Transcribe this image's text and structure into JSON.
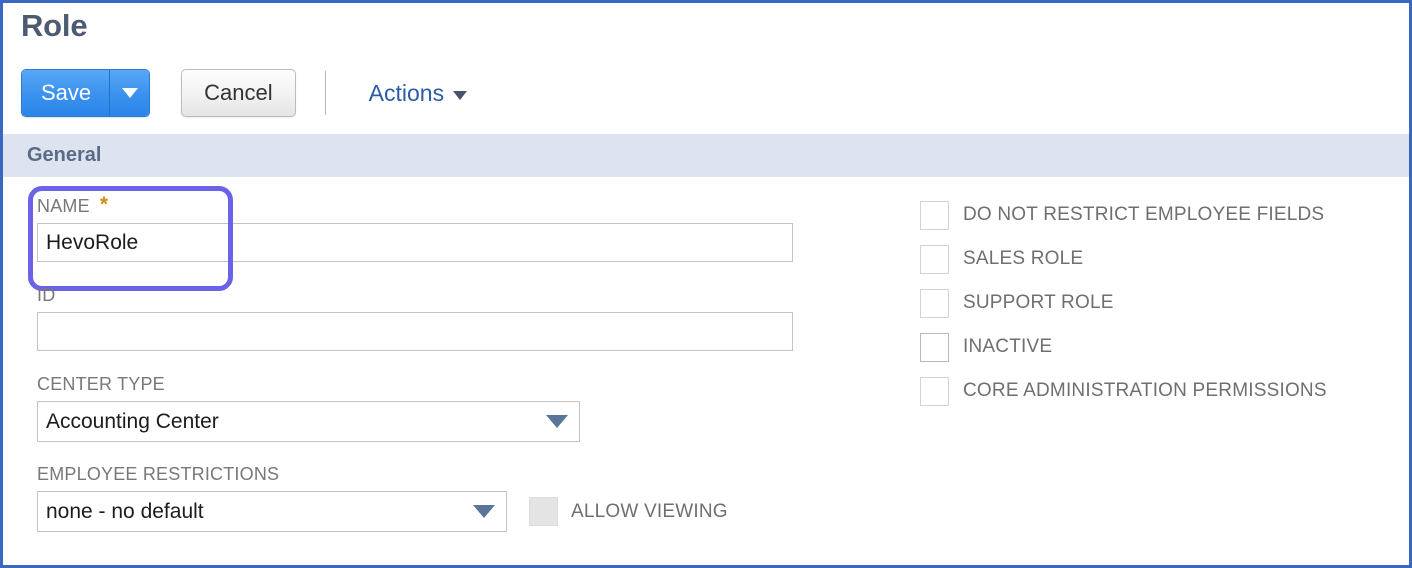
{
  "page": {
    "title": "Role",
    "border_color": "#3a68c0"
  },
  "toolbar": {
    "save_label": "Save",
    "save_dropdown_icon": "caret-down-icon",
    "cancel_label": "Cancel",
    "actions_label": "Actions",
    "actions_dropdown_icon": "caret-down-icon"
  },
  "section": {
    "general_title": "General"
  },
  "fields": {
    "name": {
      "label": "NAME",
      "required_marker": "*",
      "value": "HevoRole",
      "highlighted": true,
      "highlight_color": "#6b62e8"
    },
    "id": {
      "label": "ID",
      "value": "",
      "placeholder": ""
    },
    "center_type": {
      "label": "CENTER TYPE",
      "value": "Accounting Center",
      "dropdown_icon": "caret-down-icon"
    },
    "employee_restrictions": {
      "label": "EMPLOYEE RESTRICTIONS",
      "value": "none - no default",
      "dropdown_icon": "caret-down-icon"
    },
    "allow_viewing": {
      "label": "ALLOW VIEWING",
      "checked": false,
      "disabled": true
    }
  },
  "checkboxes": [
    {
      "label": "DO NOT RESTRICT EMPLOYEE FIELDS",
      "checked": false
    },
    {
      "label": "SALES ROLE",
      "checked": false
    },
    {
      "label": "SUPPORT ROLE",
      "checked": false
    },
    {
      "label": "INACTIVE",
      "checked": false
    },
    {
      "label": "CORE ADMINISTRATION PERMISSIONS",
      "checked": false
    }
  ]
}
